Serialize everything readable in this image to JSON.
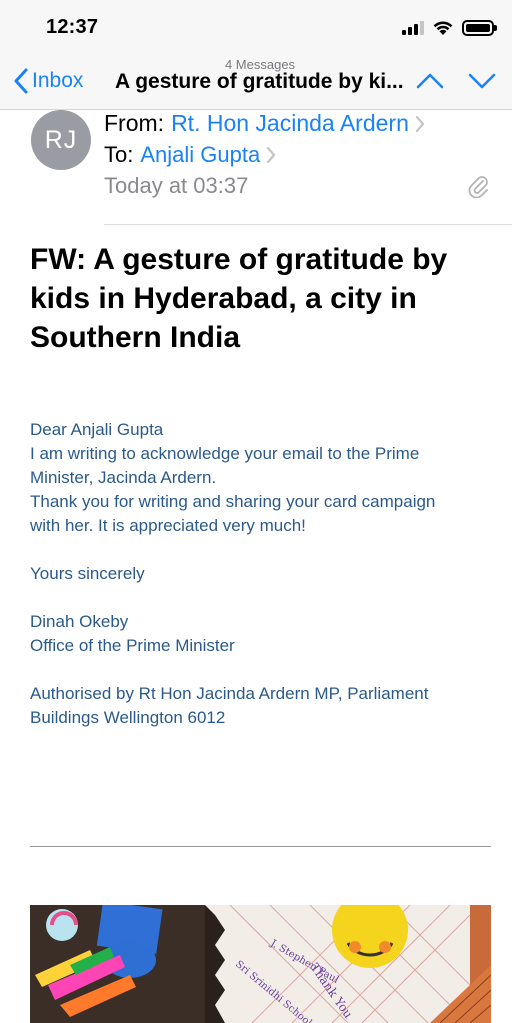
{
  "status_bar": {
    "time": "12:37"
  },
  "nav": {
    "message_count": "4 Messages",
    "back_label": "Inbox",
    "title": "A gesture of gratitude by ki..."
  },
  "header": {
    "avatar_initials": "RJ",
    "from_label": "From:",
    "from_name": "Rt. Hon Jacinda Ardern",
    "to_label": "To:",
    "to_name": "Anjali Gupta",
    "date": "Today at 03:37"
  },
  "subject": "FW:  A gesture of gratitude by kids in Hyderabad, a city in Southern India",
  "body": {
    "greeting": "Dear Anjali Gupta",
    "line1": "I am writing to acknowledge your email to the Prime",
    "line2": "Minister, Jacinda Ardern.",
    "line3": "Thank you for writing and sharing your card campaign",
    "line4": "with her. It is appreciated very much!",
    "closing": "Yours sincerely",
    "signer_name": "Dinah Okeby",
    "signer_office": "Office of the Prime Minister",
    "auth_line1": "Authorised by Rt Hon Jacinda Ardern MP, Parliament",
    "auth_line2": "Buildings  Wellington 6012"
  },
  "attachment_image": {
    "handwritten_text": [
      "Thank You",
      "J. Stephen Paul",
      "Sri Srinidhi School"
    ]
  },
  "colors": {
    "accent": "#1a82f7",
    "body_text": "#2b5a8a",
    "secondary_text": "#8a8a8e"
  }
}
